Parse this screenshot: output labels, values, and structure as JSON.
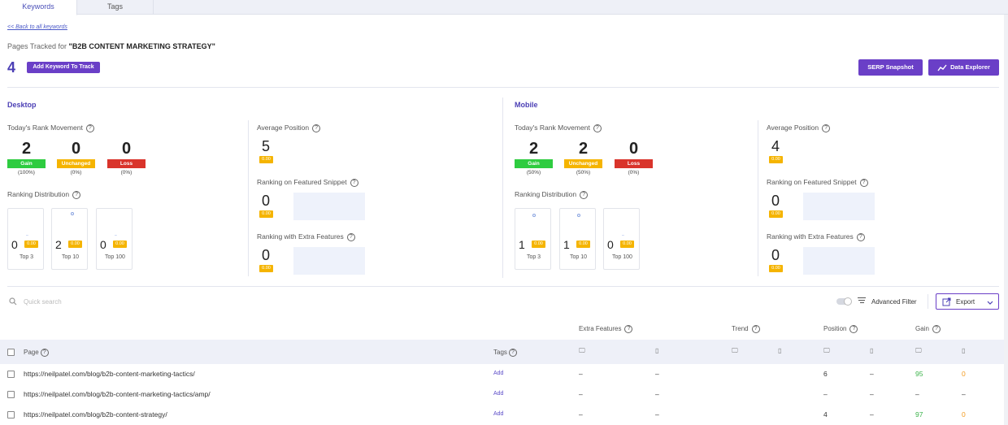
{
  "tabs": [
    {
      "label": "Keywords"
    },
    {
      "label": "Tags"
    }
  ],
  "back_link": "<< Back to all keywords",
  "pages_tracked_prefix": "Pages Tracked for ",
  "keyword": "\"B2B CONTENT MARKETING STRATEGY\"",
  "tracked_count": "4",
  "add_keyword_label": "Add Keyword To Track",
  "serp_snapshot_label": "SERP Snapshot",
  "data_explorer_label": "Data Explorer",
  "labels": {
    "rank_movement": "Today's Rank Movement",
    "ranking_distribution": "Ranking Distribution",
    "average_position": "Average Position",
    "featured_snippet": "Ranking on Featured Snippet",
    "extra_features": "Ranking with Extra Features",
    "gain": "Gain",
    "unchanged": "Unchanged",
    "loss": "Loss",
    "top3": "Top 3",
    "top10": "Top 10",
    "top100": "Top 100",
    "zero_badge": "0.00"
  },
  "desktop": {
    "title": "Desktop",
    "gain": "2",
    "gain_pct": "(100%)",
    "unchanged": "0",
    "unchanged_pct": "(0%)",
    "loss": "0",
    "loss_pct": "(0%)",
    "top3": "0",
    "top10": "2",
    "top100": "0",
    "average_position": "5",
    "featured_snippet": "0",
    "extra_features": "0"
  },
  "mobile": {
    "title": "Mobile",
    "gain": "2",
    "gain_pct": "(50%)",
    "unchanged": "2",
    "unchanged_pct": "(50%)",
    "loss": "0",
    "loss_pct": "(0%)",
    "top3": "1",
    "top10": "1",
    "top100": "0",
    "average_position": "4",
    "featured_snippet": "0",
    "extra_features": "0"
  },
  "search_placeholder": "Quick search",
  "advanced_filter_label": "Advanced Filter",
  "export_label": "Export",
  "table": {
    "group_headers": {
      "extra_features": "Extra Features",
      "trend": "Trend",
      "position": "Position",
      "gain": "Gain"
    },
    "col_page": "Page",
    "col_tags": "Tags",
    "rows": [
      {
        "page": "https://neilpatel.com/blog/b2b-content-marketing-tactics/",
        "tag": "Add",
        "extra_d": "–",
        "extra_m": "–",
        "pos_d": "6",
        "pos_m": "–",
        "gain_d": "95",
        "gain_m": "0"
      },
      {
        "page": "https://neilpatel.com/blog/b2b-content-marketing-tactics/amp/",
        "tag": "Add",
        "extra_d": "–",
        "extra_m": "–",
        "pos_d": "–",
        "pos_m": "–",
        "gain_d": "–",
        "gain_m": "–"
      },
      {
        "page": "https://neilpatel.com/blog/b2b-content-strategy/",
        "tag": "Add",
        "extra_d": "–",
        "extra_m": "–",
        "pos_d": "4",
        "pos_m": "–",
        "gain_d": "97",
        "gain_m": "0"
      }
    ]
  },
  "colors": {
    "accent": "#6a3fc7",
    "gain": "#2ecc40",
    "unchanged": "#f5b400",
    "loss": "#d9342b"
  }
}
